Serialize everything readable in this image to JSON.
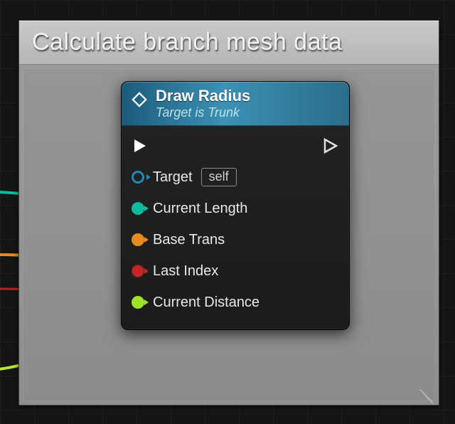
{
  "comment": {
    "title": "Calculate branch mesh data"
  },
  "node": {
    "title": "Draw Radius",
    "subtitle": "Target is Trunk",
    "pins": {
      "target": {
        "label": "Target",
        "value": "self",
        "color": "#1e8bb6"
      },
      "current_length": {
        "label": "Current Length",
        "color": "#10b89c"
      },
      "base_trans": {
        "label": "Base Trans",
        "color": "#e88a1e"
      },
      "last_index": {
        "label": "Last Index",
        "color": "#d13232"
      },
      "current_distance": {
        "label": "Current Distance",
        "color": "#9fe22a"
      }
    }
  },
  "colors": {
    "canvas": "#1c1c1c",
    "commentHeader": "#bdbdbd",
    "nodeHeaderA": "#1c5b7a",
    "nodeHeaderB": "#3c91b4"
  }
}
